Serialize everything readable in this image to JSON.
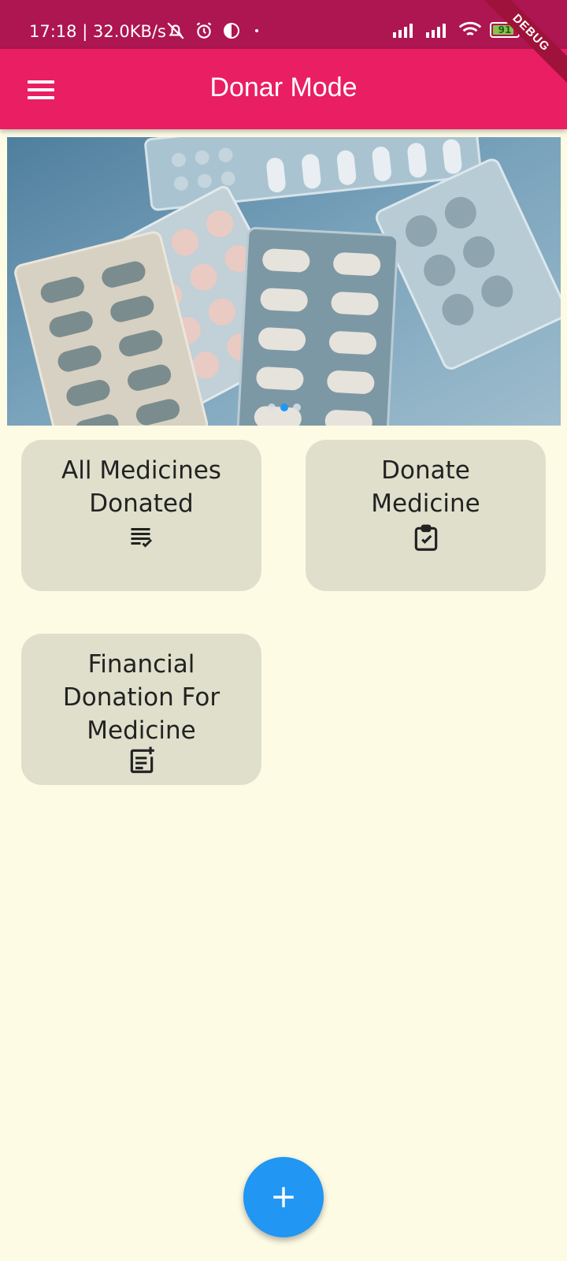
{
  "status_bar": {
    "time": "17:18",
    "speed": "32.0KB/s",
    "battery": "91"
  },
  "debug_banner": "DEBUG",
  "app_bar": {
    "title": "Donar Mode"
  },
  "carousel": {
    "dot_count": 3,
    "active_dot": 2
  },
  "cards": [
    {
      "label": "All Medicines Donated",
      "icon": "list-check-icon"
    },
    {
      "label": "Donate Medicine",
      "icon": "clipboard-check-icon"
    },
    {
      "label": "Financial Donation For Medicine",
      "icon": "note-add-icon"
    }
  ],
  "fab": {
    "icon": "plus-icon"
  },
  "colors": {
    "status_bar": "#ad1650",
    "app_bar": "#e91e63",
    "background": "#fdfbe4",
    "card": "#dfdfcc",
    "fab": "#2196f3"
  }
}
